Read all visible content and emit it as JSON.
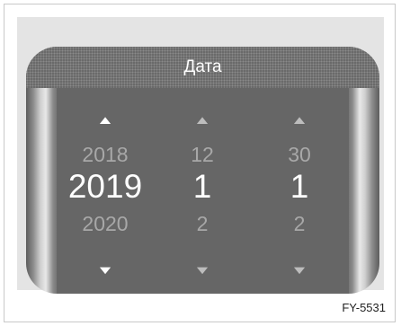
{
  "header": {
    "title": "Дата"
  },
  "picker": {
    "year": {
      "prev": "2018",
      "current": "2019",
      "next": "2020"
    },
    "month": {
      "prev": "12",
      "current": "1",
      "next": "2"
    },
    "day": {
      "prev": "30",
      "current": "1",
      "next": "2"
    }
  },
  "icons": {
    "up": "▲",
    "down": "▼"
  },
  "figure_code": "FY-5531"
}
